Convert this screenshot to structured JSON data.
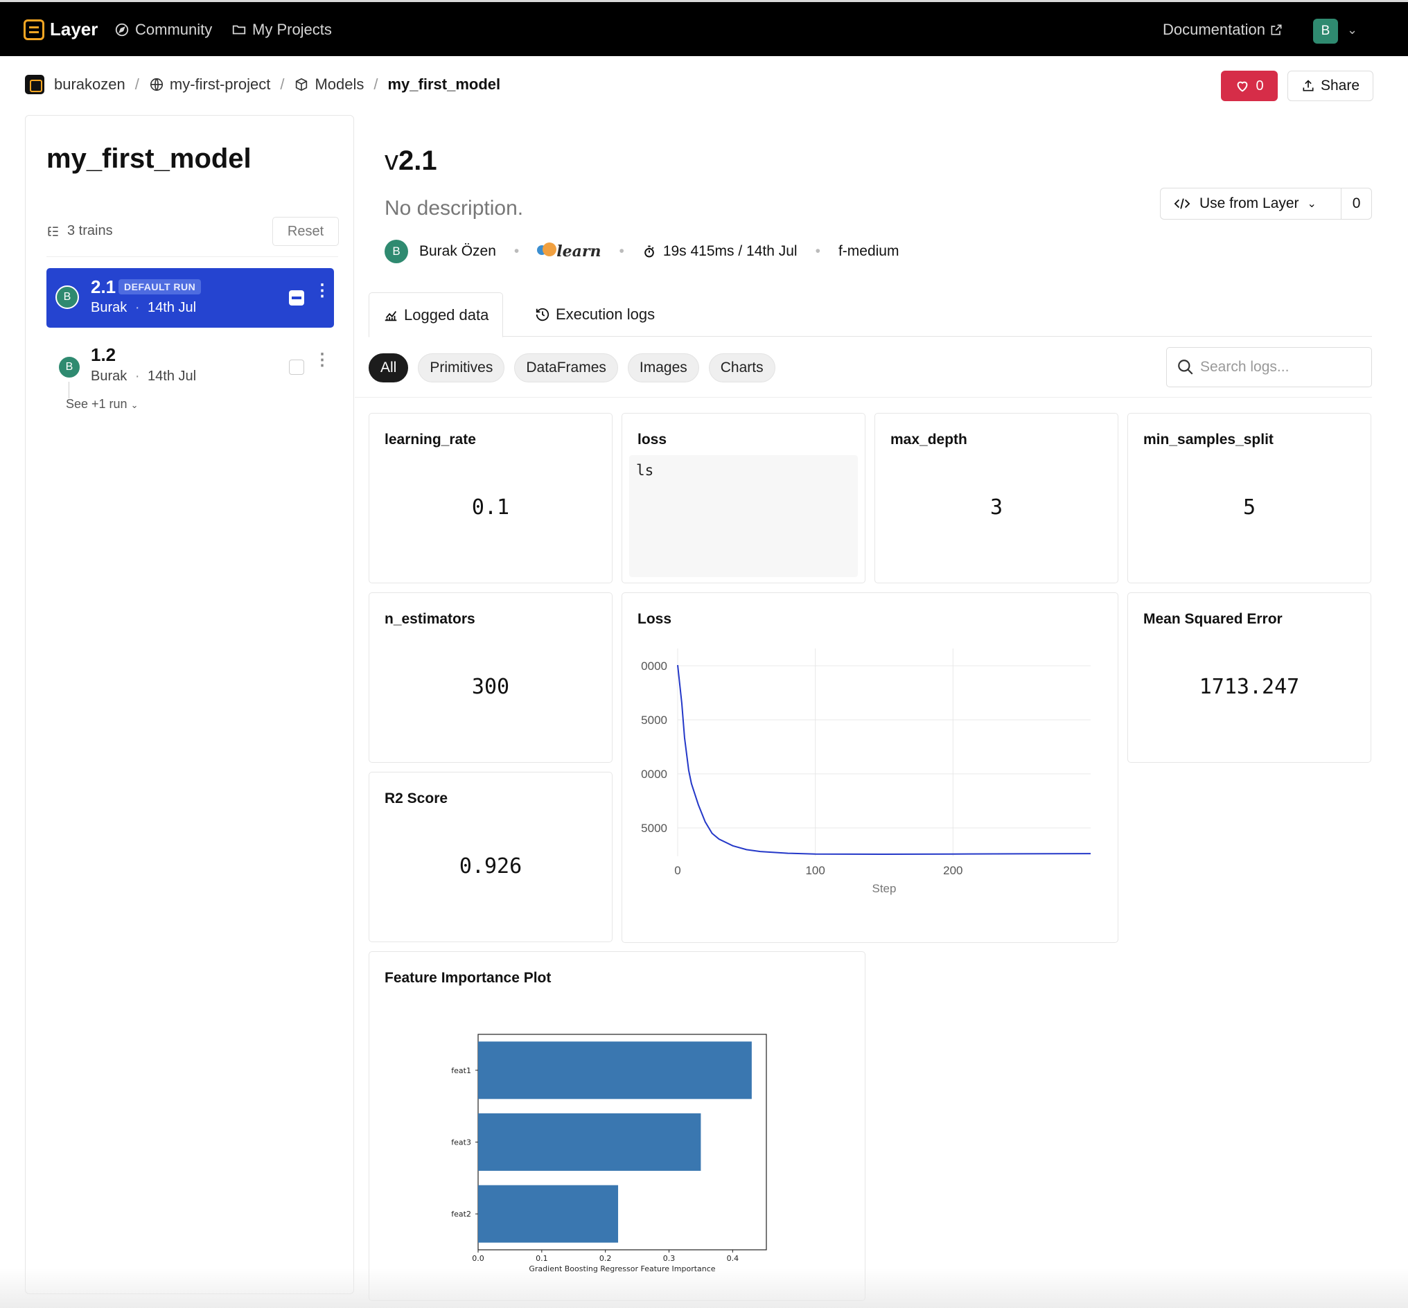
{
  "topbar": {
    "brand": "Layer",
    "nav": [
      {
        "label": "Community",
        "icon": "compass-icon"
      },
      {
        "label": "My Projects",
        "icon": "folder-icon"
      }
    ],
    "documentation": "Documentation",
    "avatar_initial": "B"
  },
  "breadcrumb": {
    "org": "burakozen",
    "project": "my-first-project",
    "section": "Models",
    "current": "my_first_model"
  },
  "actions": {
    "like_count": "0",
    "share_label": "Share"
  },
  "sidebar": {
    "title": "my_first_model",
    "trains_label": "3 trains",
    "reset_label": "Reset",
    "runs": [
      {
        "version": "2.1",
        "badge": "DEFAULT RUN",
        "author": "Burak",
        "date": "14th Jul",
        "initial": "B",
        "active": true
      },
      {
        "version": "1.2",
        "author": "Burak",
        "date": "14th Jul",
        "initial": "B",
        "active": false
      }
    ],
    "see_more": "See +1 run"
  },
  "main": {
    "version_prefix": "v",
    "version": "2.1",
    "description": "No description.",
    "author": "Burak Özen",
    "author_initial": "B",
    "framework": "learn",
    "duration": "19s 415ms / 14th Jul",
    "fabric": "f-medium",
    "use_label": "Use from Layer",
    "use_count": "0",
    "tabs": [
      {
        "label": "Logged data",
        "active": true
      },
      {
        "label": "Execution logs",
        "active": false
      }
    ],
    "filters": [
      "All",
      "Primitives",
      "DataFrames",
      "Images",
      "Charts"
    ],
    "active_filter": "All",
    "search_placeholder": "Search logs..."
  },
  "cards": {
    "learning_rate": {
      "title": "learning_rate",
      "value": "0.1"
    },
    "loss": {
      "title": "loss",
      "value": "ls"
    },
    "max_depth": {
      "title": "max_depth",
      "value": "3"
    },
    "min_samples_split": {
      "title": "min_samples_split",
      "value": "5"
    },
    "n_estimators": {
      "title": "n_estimators",
      "value": "300"
    },
    "mse": {
      "title": "Mean Squared Error",
      "value": "1713.247"
    },
    "r2": {
      "title": "R2 Score",
      "value": "0.926"
    },
    "loss_chart": {
      "title": "Loss"
    },
    "feature_importance": {
      "title": "Feature Importance Plot"
    }
  },
  "chart_data": [
    {
      "type": "line",
      "title": "Loss",
      "xlabel": "Step",
      "ylabel": "",
      "x_ticks": [
        0,
        100,
        200
      ],
      "y_tick_labels": [
        "0000",
        "5000",
        "0000",
        "5000"
      ],
      "xlim": [
        0,
        300
      ],
      "line_color": "#2438c8",
      "grid": true,
      "series": [
        {
          "x": [
            0,
            3,
            5,
            8,
            10,
            15,
            20,
            25,
            30,
            40,
            50,
            60,
            80,
            100,
            150,
            200,
            250,
            300
          ],
          "y_rel": [
            1.0,
            0.8,
            0.62,
            0.45,
            0.38,
            0.27,
            0.18,
            0.12,
            0.09,
            0.055,
            0.035,
            0.025,
            0.016,
            0.012,
            0.011,
            0.012,
            0.013,
            0.014
          ]
        }
      ]
    },
    {
      "type": "bar",
      "orientation": "horizontal",
      "xlabel": "Gradient Boosting Regressor Feature Importance",
      "categories": [
        "feat1",
        "feat3",
        "feat2"
      ],
      "values": [
        0.43,
        0.35,
        0.22
      ],
      "x_ticks": [
        0.0,
        0.1,
        0.2,
        0.3,
        0.4
      ],
      "xlim": [
        0,
        0.453
      ],
      "bar_color": "#3a77b0"
    }
  ]
}
